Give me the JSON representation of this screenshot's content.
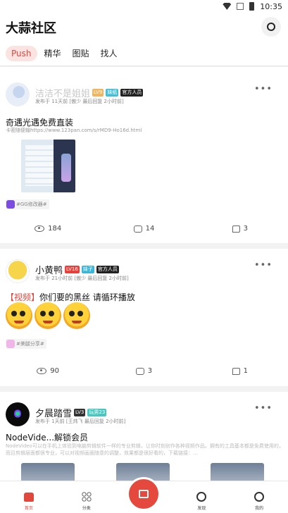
{
  "statusbar": {
    "time": "10:35"
  },
  "app": {
    "title": "大蒜社区"
  },
  "tabs": [
    {
      "label": "Push"
    },
    {
      "label": "精华"
    },
    {
      "label": "图贴"
    },
    {
      "label": "找人"
    }
  ],
  "posts": [
    {
      "username": "洁洁不是姐姐",
      "badges": [
        "LV9",
        "妹纸",
        "官方人员"
      ],
      "meta": "发布于 11天前  [傲少 最后回复 2小时前]",
      "title": "奇遇光遇免费直装",
      "text": "卡密随便输https://www.123pan.com/s/rMD9-Ho16d.html",
      "topic": "#GG修改器#",
      "views": "184",
      "comments": "14",
      "likes": "3"
    },
    {
      "username": "小黄鸭",
      "badges": [
        "LV16",
        "妹子",
        "官方人员"
      ],
      "meta": "发布于 21小时前  [傲少 最后回复 2小时前]",
      "tag": "【视频】",
      "title": "你们要的黑丝 请循环播放",
      "topic": "#美腿分享#",
      "views": "90",
      "comments": "3",
      "likes": "1"
    },
    {
      "username": "夕晨踏雪",
      "badges": [
        "LV3",
        "玩男23"
      ],
      "meta": "发布于 1天前  [王炜飞 最后回复 2小时前]",
      "title": "NodeVide...解锁会员",
      "text": "NodeVideo可以在手机上体验到电脑剪辑软件一样的专业剪辑，让你时刻创作各种视频作品。拥有的工具基本都是免费使用的，而且剪辑层面都很专业，可以对视频画面随意的调整，效果都是很好看的，下载链接：…"
    }
  ],
  "bottomnav": [
    {
      "label": "首页"
    },
    {
      "label": "分类"
    },
    {
      "label": ""
    },
    {
      "label": "发现"
    },
    {
      "label": "我的"
    }
  ]
}
